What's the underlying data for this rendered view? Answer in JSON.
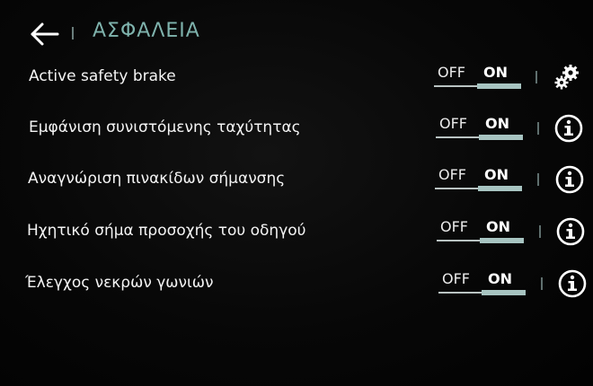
{
  "header": {
    "title": "ΑΣΦΑΛΕΙΑ",
    "back_icon": "arrow-left-icon"
  },
  "settings": [
    {
      "label": "Active safety brake",
      "off_label": "OFF",
      "on_label": "ON",
      "state": "on",
      "action_icon": "gears-icon"
    },
    {
      "label": "Εμφάνιση συνιστόμενης ταχύτητας",
      "off_label": "OFF",
      "on_label": "ON",
      "state": "on",
      "action_icon": "info-icon"
    },
    {
      "label": "Αναγνώριση πινακίδων σήμανσης",
      "off_label": "OFF",
      "on_label": "ON",
      "state": "on",
      "action_icon": "info-icon"
    },
    {
      "label": "Ηχητικό σήμα προσοχής του οδηγού",
      "off_label": "OFF",
      "on_label": "ON",
      "state": "on",
      "action_icon": "info-icon"
    },
    {
      "label": "Έλεγχος νεκρών γωνιών",
      "off_label": "OFF",
      "on_label": "ON",
      "state": "on",
      "action_icon": "info-icon"
    }
  ],
  "colors": {
    "background": "#050505",
    "title": "#7fb3ad",
    "toggle_active": "#a7c4c1",
    "text": "#f4f4f4"
  }
}
